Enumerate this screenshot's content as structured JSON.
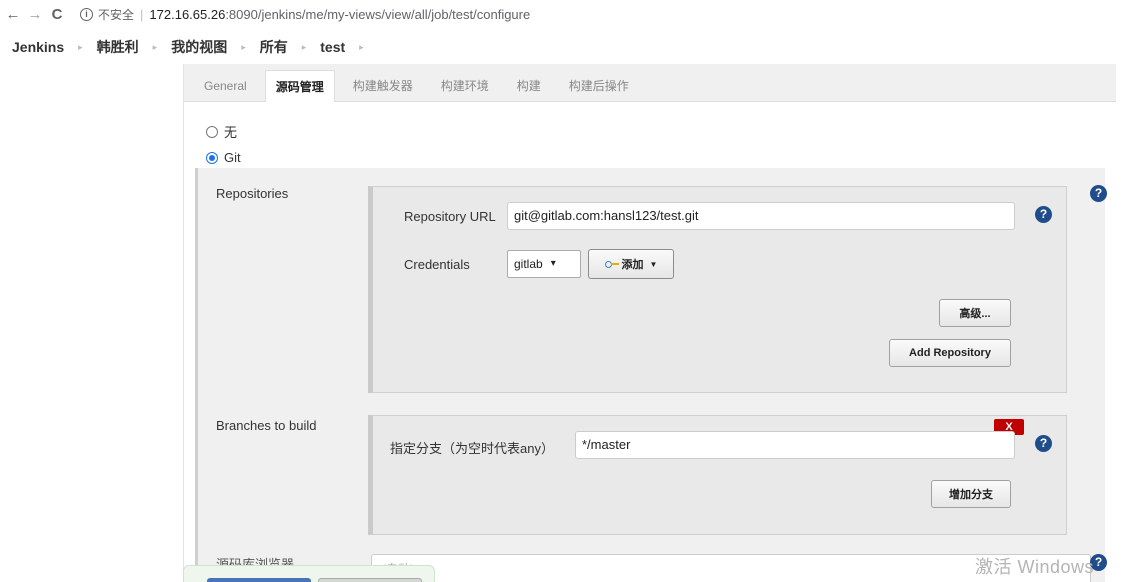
{
  "browser": {
    "back_icon": "←",
    "forward_icon": "→",
    "reload_icon": "C",
    "info_icon": "i",
    "insecure_label": "不安全",
    "separator": "|",
    "url_host": "172.16.65.26",
    "url_rest": ":8090/jenkins/me/my-views/view/all/job/test/configure"
  },
  "breadcrumbs": {
    "items": [
      "Jenkins",
      "韩胜利",
      "我的视图",
      "所有",
      "test"
    ],
    "separator": "▸"
  },
  "tabs": [
    "General",
    "源码管理",
    "构建触发器",
    "构建环境",
    "构建",
    "构建后操作"
  ],
  "scm": {
    "option_none": "无",
    "option_git": "Git",
    "selected": "Git"
  },
  "repositories": {
    "section_label": "Repositories",
    "url_label": "Repository URL",
    "url_value": "git@gitlab.com:hansl123/test.git",
    "credentials_label": "Credentials",
    "credentials_value": "gitlab",
    "add_label": "添加",
    "advanced_label": "高级...",
    "add_repo_label": "Add Repository"
  },
  "branches": {
    "section_label": "Branches to build",
    "spec_label": "指定分支（为空时代表any）",
    "spec_value": "*/master",
    "delete_label": "X",
    "add_branch_label": "增加分支"
  },
  "browser_section": {
    "label": "源码库浏览器",
    "value": "(自动)"
  },
  "help_icon": "?",
  "watermark": "激活 Windows",
  "colors": {
    "help": "#1f4d8c",
    "delete": "#c00000",
    "radio_checked": "#1a73e8"
  }
}
